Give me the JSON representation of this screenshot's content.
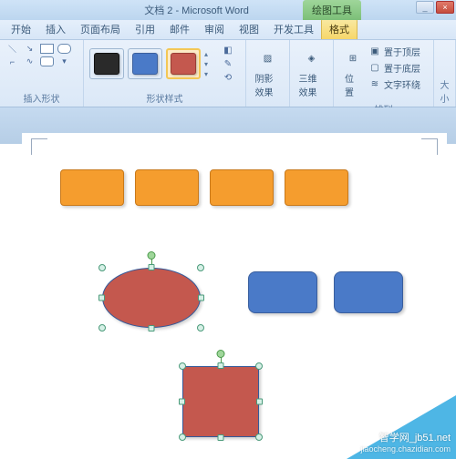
{
  "title": {
    "doc": "文档 2 - Microsoft Word",
    "context": "绘图工具"
  },
  "win": {
    "minimize": "_",
    "close": "×"
  },
  "tabs": {
    "start": "开始",
    "insert": "插入",
    "pagelayout": "页面布局",
    "ref": "引用",
    "mail": "邮件",
    "review": "审阅",
    "view": "视图",
    "dev": "开发工具",
    "format": "格式"
  },
  "groups": {
    "insert_shape": "插入形状",
    "shape_style": "形状样式",
    "arrange": "排列",
    "size": "大小"
  },
  "effects": {
    "shadow": "阴影效果",
    "threed": "三维效果",
    "position": "位置"
  },
  "arrange": {
    "front": "置于顶层",
    "back": "置于底层",
    "wrap": "文字环绕"
  },
  "watermark": {
    "site": "智学网_jb51.net",
    "sub": "jiaocheng.chazidian.com"
  },
  "icons": {
    "dropdown": "▾",
    "line": "＼",
    "arrow": "↘",
    "rect": "▭",
    "ellipse": "○",
    "fill": "◧",
    "outline": "✎",
    "change": "⟲",
    "shadow": "▨",
    "threed": "◈",
    "pos": "⊞",
    "front": "▣",
    "back": "▢",
    "wrap": "≋"
  },
  "chart_data": null
}
